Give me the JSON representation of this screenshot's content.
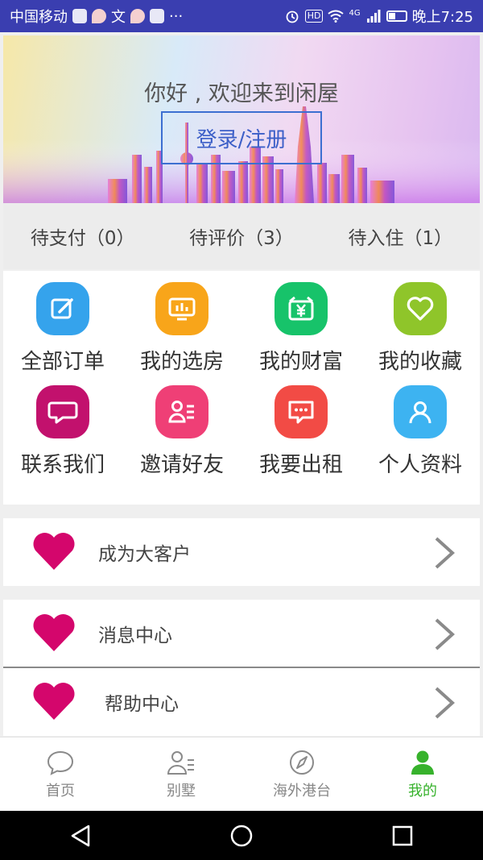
{
  "status_bar": {
    "carrier": "中国移动",
    "extra_glyph": "文",
    "more": "···",
    "hd": "HD",
    "network": "4G",
    "time": "晚上7:25"
  },
  "hero": {
    "greeting": "你好 , 欢迎来到闲屋",
    "login_label": "登录/注册"
  },
  "order_tabs": [
    {
      "label": "待支付（0）"
    },
    {
      "label": "待评价（3）"
    },
    {
      "label": "待入住（1）"
    }
  ],
  "grid": [
    {
      "label": "全部订单",
      "icon": "edit-icon",
      "color": "#35a3ec"
    },
    {
      "label": "我的选房",
      "icon": "screen-icon",
      "color": "#f8a51a"
    },
    {
      "label": "我的财富",
      "icon": "yuan-icon",
      "color": "#17c36a"
    },
    {
      "label": "我的收藏",
      "icon": "heart-icon",
      "color": "#8fc52a"
    },
    {
      "label": "联系我们",
      "icon": "chat-icon",
      "color": "#c2116d"
    },
    {
      "label": "邀请好友",
      "icon": "contact-icon",
      "color": "#ef3f76"
    },
    {
      "label": "我要出租",
      "icon": "message-icon",
      "color": "#f24b45"
    },
    {
      "label": "个人资料",
      "icon": "user-icon",
      "color": "#3db3f1"
    }
  ],
  "rows": [
    {
      "label": "成为大客户"
    },
    {
      "label": "消息中心"
    },
    {
      "label": "帮助中心"
    }
  ],
  "accent": {
    "heart": "#d4066c",
    "active_tab": "#37b22c"
  },
  "bottom_nav": [
    {
      "label": "首页",
      "icon": "chat-bubble-icon"
    },
    {
      "label": "别墅",
      "icon": "contacts-icon"
    },
    {
      "label": "海外港台",
      "icon": "compass-icon"
    },
    {
      "label": "我的",
      "icon": "person-icon"
    }
  ]
}
